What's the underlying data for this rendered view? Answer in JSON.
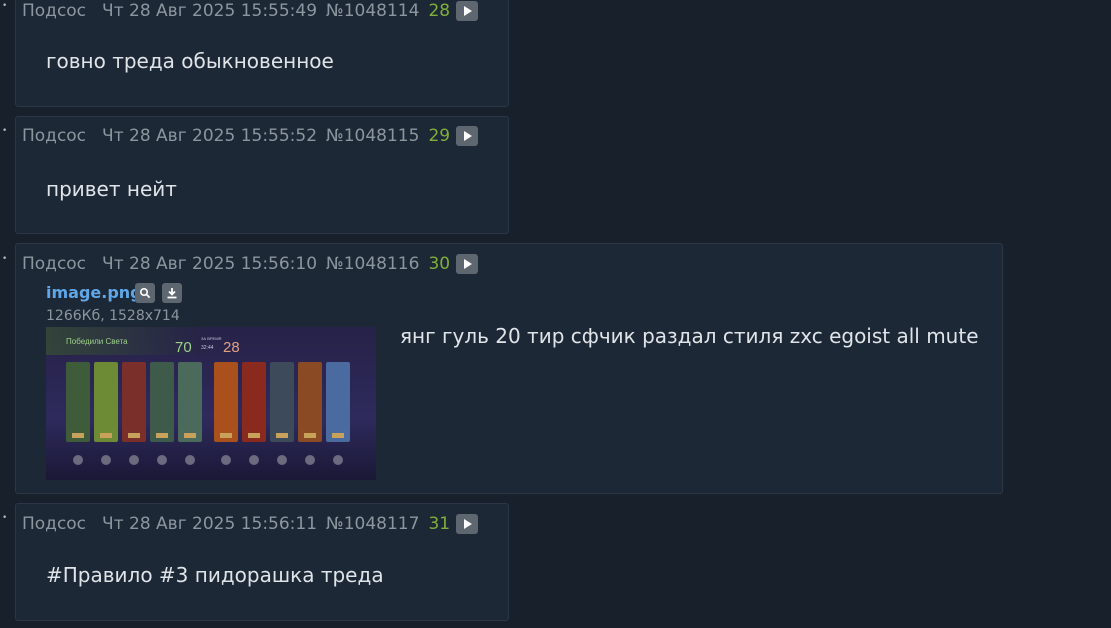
{
  "posts": [
    {
      "author": "Подсос",
      "date": "Чт 28 Авг 2025 15:55:49",
      "number": "№1048114",
      "count": "28",
      "text": "говно треда обыкновенное"
    },
    {
      "author": "Подсос",
      "date": "Чт 28 Авг 2025 15:55:52",
      "number": "№1048115",
      "count": "29",
      "text": "привет нейт"
    },
    {
      "author": "Подсос",
      "date": "Чт 28 Авг 2025 15:56:10",
      "number": "№1048116",
      "count": "30",
      "text": "янг гуль 20 тир сфчик раздал стиля zxc egoist all mute",
      "file": {
        "name": "image.png",
        "meta": "1266Кб, 1528x714",
        "thumb_texts": {
          "title": "Победили Света",
          "score_left": "70",
          "score_right": "28",
          "small_top": "ЗА ВРЕМЯ",
          "small_bottom": "32:44"
        }
      }
    },
    {
      "author": "Подсос",
      "date": "Чт 28 Авг 2025 15:56:11",
      "number": "№1048117",
      "count": "31",
      "text": "#Правило #3 пидорашка треда"
    }
  ],
  "colors": {
    "background": "#17202b",
    "post_background": "#1d2836",
    "post_border": "#2b3747",
    "meta_text": "#8d969f",
    "count_green": "#7fae3b",
    "file_link": "#5fa7e8",
    "body_text": "#e0e4e8"
  },
  "icons": {
    "play": "play-icon",
    "search": "magnifier-icon",
    "download": "download-icon"
  }
}
